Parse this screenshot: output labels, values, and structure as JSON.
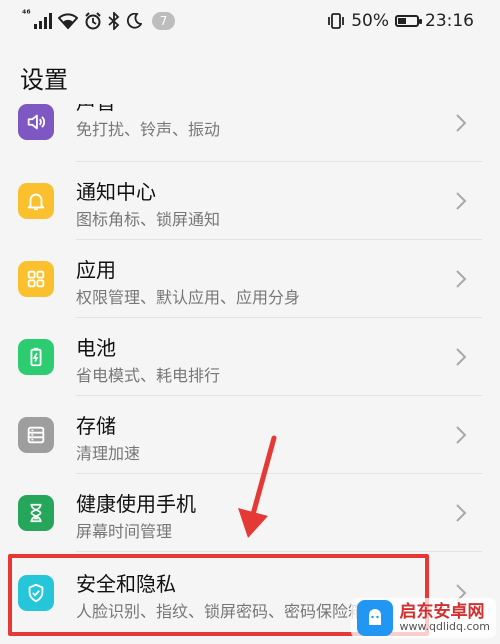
{
  "statusbar": {
    "network": "⁴⁶",
    "notification_count": "7",
    "battery": "50%",
    "battery_level": 0.5,
    "time": "23:16",
    "icons": [
      "signal-icon",
      "wifi-icon",
      "alarm-icon",
      "bluetooth-icon",
      "moon-icon",
      "vibrate-icon",
      "battery-icon"
    ]
  },
  "header": {
    "title": "设置"
  },
  "items": [
    {
      "title": "声音",
      "subtitle": "免打扰、铃声、振动",
      "icon": "speaker-icon",
      "color": "#7e57c2"
    },
    {
      "title": "通知中心",
      "subtitle": "图标角标、锁屏通知",
      "icon": "bell-icon",
      "color": "#fbc02d"
    },
    {
      "title": "应用",
      "subtitle": "权限管理、默认应用、应用分身",
      "icon": "apps-grid-icon",
      "color": "#fbc02d"
    },
    {
      "title": "电池",
      "subtitle": "省电模式、耗电排行",
      "icon": "battery-charging-icon",
      "color": "#2ecc71"
    },
    {
      "title": "存储",
      "subtitle": "清理加速",
      "icon": "storage-icon",
      "color": "#9e9e9e"
    },
    {
      "title": "健康使用手机",
      "subtitle": "屏幕时间管理",
      "icon": "hourglass-icon",
      "color": "#26a65b"
    },
    {
      "title": "安全和隐私",
      "subtitle": "人脸识别、指纹、锁屏密码、密码保险箱",
      "icon": "shield-check-icon",
      "color": "#26c6da"
    }
  ],
  "watermark": {
    "title": "启东安卓网",
    "url": "www.qdlidq.com"
  }
}
